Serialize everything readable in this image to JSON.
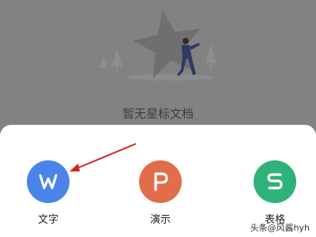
{
  "empty_state": {
    "message": "暂无星标文档"
  },
  "apps": [
    {
      "label": "文字",
      "icon": "writer-w-icon",
      "color": "#4a84e8"
    },
    {
      "label": "演示",
      "icon": "presentation-p-icon",
      "color": "#e26d4a"
    },
    {
      "label": "表格",
      "icon": "spreadsheet-s-icon",
      "color": "#2fb27a"
    }
  ],
  "watermark": {
    "text": "头条@风酱hyh"
  }
}
